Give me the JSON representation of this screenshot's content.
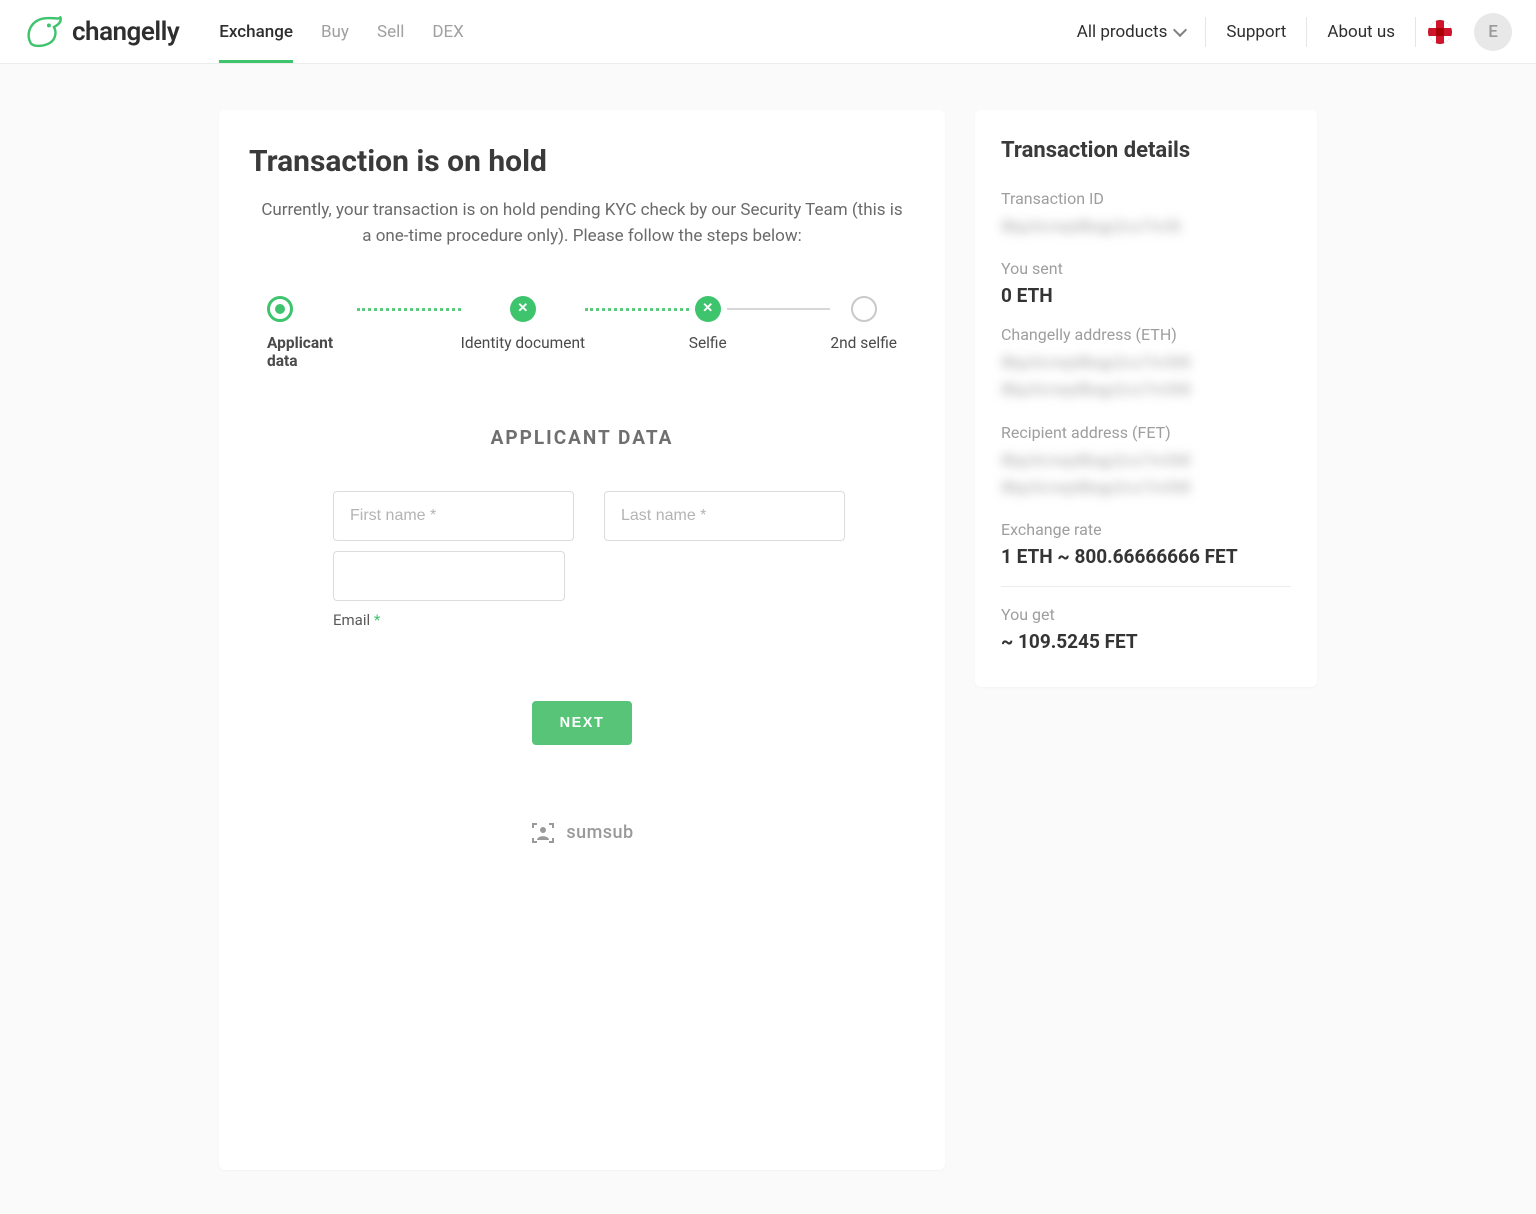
{
  "brand": "changelly",
  "nav": {
    "items": [
      "Exchange",
      "Buy",
      "Sell",
      "DEX"
    ],
    "activeIndex": 0
  },
  "header": {
    "allProducts": "All products",
    "support": "Support",
    "aboutUs": "About us",
    "avatarInitial": "E",
    "locale": "en-GB"
  },
  "main": {
    "title": "Transaction is on hold",
    "subtitle": "Currently, your transaction is on hold pending KYC check by our Security Team (this is a one-time procedure only). Please follow the steps below:",
    "steps": [
      {
        "label": "Applicant data",
        "state": "current"
      },
      {
        "label": "Identity document",
        "state": "error"
      },
      {
        "label": "Selfie",
        "state": "error"
      },
      {
        "label": "2nd selfie",
        "state": "pending"
      }
    ],
    "form": {
      "heading": "APPLICANT DATA",
      "firstNamePlaceholder": "First name *",
      "lastNamePlaceholder": "Last name *",
      "emailLabel": "Email",
      "emailRequiredMark": "*",
      "firstName": "",
      "lastName": "",
      "email": "",
      "nextButton": "NEXT"
    },
    "poweredBy": "sumsub"
  },
  "details": {
    "title": "Transaction details",
    "transactionIdLabel": "Transaction ID",
    "transactionId": "8bp3crwp8bqp2cx7m5t",
    "youSentLabel": "You sent",
    "youSent": "0 ETH",
    "changellyAddressLabel": "Changelly address (ETH)",
    "changellyAddress": "8bp3crwp8bqp2cx7m5t8\n8bp3crwp8bqp2cx7m5t8",
    "recipientAddressLabel": "Recipient address (FET)",
    "recipientAddress": "8bp3crwp8bqp2cx7m5t8\n8bp3crwp8bqp2cx7m5t8",
    "exchangeRateLabel": "Exchange rate",
    "exchangeRate": "1 ETH ~ 800.66666666 FET",
    "youGetLabel": "You get",
    "youGet": "~ 109.5245 FET"
  }
}
